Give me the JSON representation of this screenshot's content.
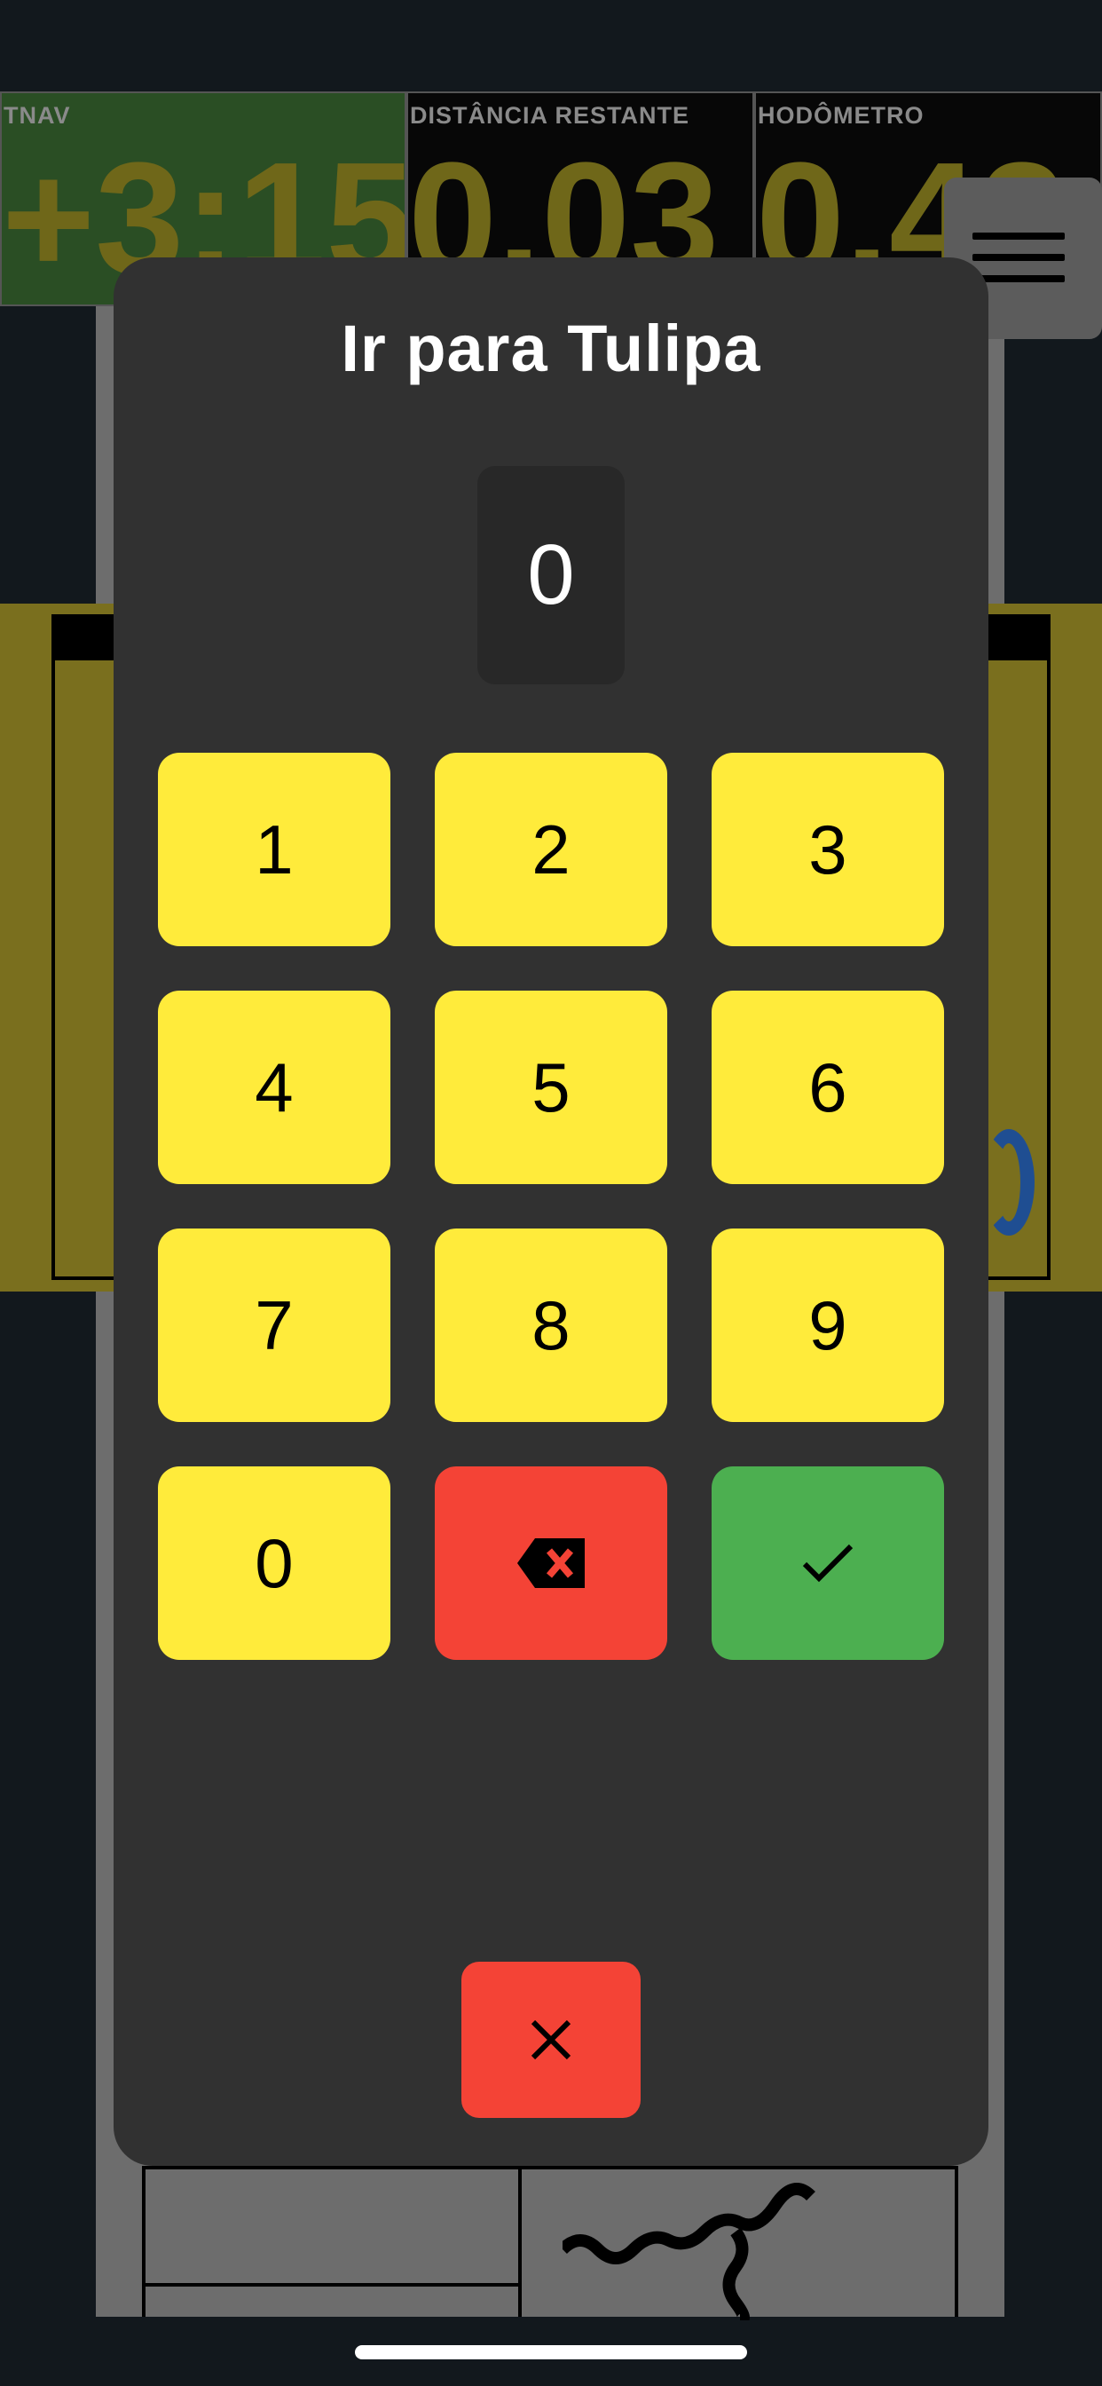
{
  "background": {
    "stats": [
      {
        "label": "TNAV",
        "value": "+3:15"
      },
      {
        "label": "DISTÂNCIA RESTANTE",
        "value": "0.03"
      },
      {
        "label": "HODÔMETRO",
        "value": "0.42"
      }
    ]
  },
  "dialog": {
    "title": "Ir para Tulipa",
    "display_value": "0",
    "keys": [
      "1",
      "2",
      "3",
      "4",
      "5",
      "6",
      "7",
      "8",
      "9",
      "0"
    ],
    "backspace_icon": "backspace-icon",
    "confirm_icon": "check-icon",
    "close_icon": "close-icon"
  },
  "colors": {
    "key_yellow": "#ffeb3b",
    "danger_red": "#f44336",
    "confirm_green": "#4caf50",
    "dialog_bg": "#313131"
  }
}
